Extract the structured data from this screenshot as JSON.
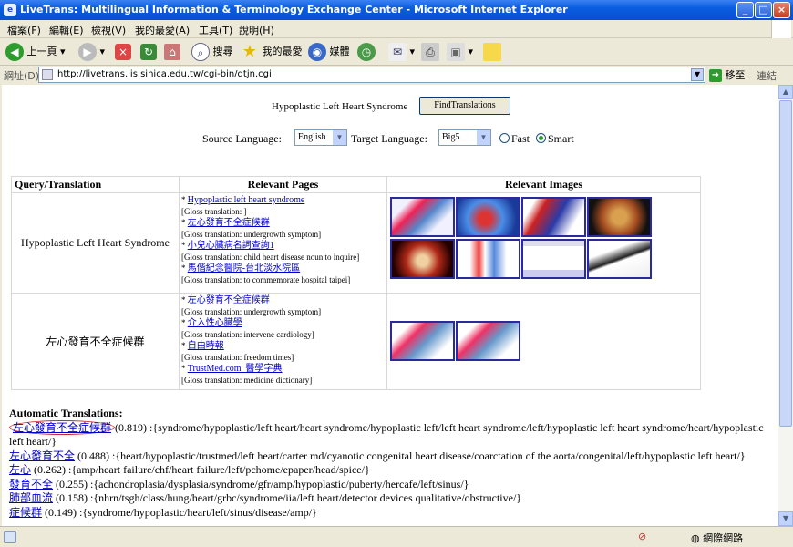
{
  "window": {
    "title": "LiveTrans: Multilingual Information & Terminology Exchange Center - Microsoft Internet Explorer",
    "minimize": "_",
    "maximize": "□",
    "close": "×"
  },
  "menu": [
    "檔案(F)",
    "編輯(E)",
    "檢視(V)",
    "我的最愛(A)",
    "工具(T)",
    "說明(H)"
  ],
  "toolbar": {
    "back": "上一頁",
    "search": "搜尋",
    "favorites": "我的最愛",
    "media": "媒體"
  },
  "address": {
    "label": "網址(D)",
    "url": "http://livetrans.iis.sinica.edu.tw/cgi-bin/qtjn.cgi",
    "go": "移至",
    "links": "連結"
  },
  "search": {
    "query": "Hypoplastic Left Heart Syndrome",
    "button": "FindTranslations",
    "source_label": "Source Language:",
    "source_value": "English",
    "target_label": "Target Language:",
    "target_value": "Big5",
    "fast_label": "Fast",
    "smart_label": "Smart"
  },
  "table": {
    "headers": [
      "Query/Translation",
      "Relevant Pages",
      "Relevant Images"
    ],
    "rows": [
      {
        "query": "Hypoplastic Left Heart Syndrome",
        "pages": [
          {
            "title": "Hypoplastic left heart syndrome",
            "gloss": "[Gloss translation: ]"
          },
          {
            "title": "左心發育不全症候群",
            "gloss": "[Gloss translation: undergrowth symptom]"
          },
          {
            "title": "小兒心臟病名詞查詢1",
            "gloss": "[Gloss translation: child heart disease noun to inquire]"
          },
          {
            "title": "馬偕紀念醫院-台北淡水院區",
            "gloss": "[Gloss translation: to commemorate hospital taipei]"
          }
        ]
      },
      {
        "query": "左心發育不全症候群",
        "pages": [
          {
            "title": "左心發育不全症候群",
            "gloss": "[Gloss translation: undergrowth symptom]"
          },
          {
            "title": "介入性心臟學",
            "gloss": "[Gloss translation: intervene cardiology]"
          },
          {
            "title": "自由時報",
            "gloss": "[Gloss translation: freedom times]"
          },
          {
            "title": "TrustMed.com_醫學字典",
            "gloss": "[Gloss translation: medicine dictionary]"
          }
        ]
      }
    ]
  },
  "auto": {
    "heading": "Automatic Translations:",
    "items": [
      {
        "term": "左心發育不全症候群",
        "score": "(0.819)",
        "text": " :{syndrome/hypoplastic/left heart/heart syndrome/hypoplastic left/left heart syndrome/left/hypoplastic left heart syndrome/heart/hypoplastic left heart/}"
      },
      {
        "term": "左心發育不全",
        "score": "(0.488)",
        "text": " :{heart/hypoplastic/trustmed/left heart/carter md/cyanotic congenital heart disease/coarctation of the aorta/congenital/left/hypoplastic left heart/}"
      },
      {
        "term": "左心",
        "score": "(0.262)",
        "text": " :{amp/heart failure/chf/heart failure/left/pchome/epaper/head/spice/}"
      },
      {
        "term": "發育不全",
        "score": "(0.255)",
        "text": " :{achondroplasia/dysplasia/syndrome/gfr/amp/hypoplastic/puberty/hercafe/left/sinus/}"
      },
      {
        "term": "肺部血流",
        "score": "(0.158)",
        "text": " :{nhrn/tsgh/class/hung/heart/grbc/syndrome/iia/left heart/detector devices qualitative/obstructive/}"
      },
      {
        "term": "症候群",
        "score": "(0.149)",
        "text": " :{syndrome/hypoplastic/heart/left/sinus/disease/amp/}"
      }
    ]
  },
  "status": {
    "zone": "網際網路"
  },
  "colors": {
    "title_bar": "#0a5de0",
    "link": "#0000cc",
    "thumb_border": "#2a2a9a",
    "circle": "#d02020"
  }
}
